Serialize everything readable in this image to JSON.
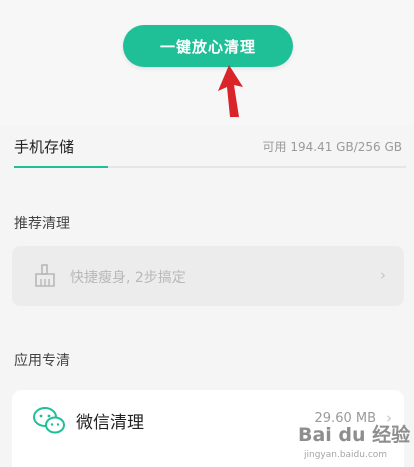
{
  "header": {
    "clean_button_label": "一键放心清理"
  },
  "storage": {
    "title": "手机存储",
    "info": "可用 194.41 GB/256 GB",
    "used_fraction": 0.24
  },
  "recommend": {
    "title": "推荐清理",
    "quick_item_label": "快捷瘦身, 2步搞定"
  },
  "apps": {
    "title": "应用专清",
    "items": [
      {
        "label": "微信清理",
        "size": "29.60 MB"
      }
    ]
  },
  "watermark": {
    "main": "Bai du 经验",
    "sub": "jingyan.baidu.com"
  },
  "colors": {
    "accent": "#1fbf97",
    "arrow": "#d9242a"
  },
  "icons": {
    "quick": "broom-icon",
    "wechat": "wechat-icon",
    "chevron": "chevron-right-icon"
  }
}
